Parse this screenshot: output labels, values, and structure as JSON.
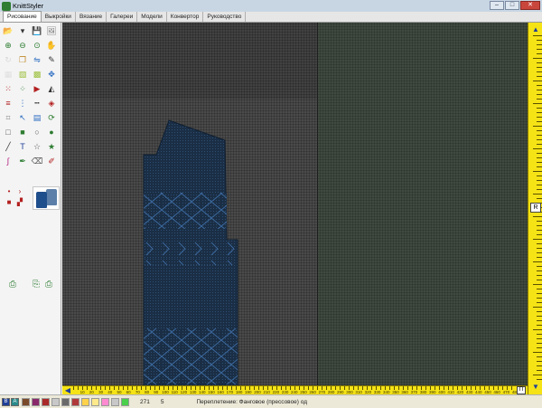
{
  "window": {
    "title": "KnittStyler"
  },
  "tabs": [
    {
      "label": "Рисование",
      "active": true
    },
    {
      "label": "Выкройки",
      "active": false
    },
    {
      "label": "Вязание",
      "active": false
    },
    {
      "label": "Галереи",
      "active": false
    },
    {
      "label": "Модели",
      "active": false
    },
    {
      "label": "Конвертор",
      "active": false
    },
    {
      "label": "Руководство",
      "active": false
    }
  ],
  "toolbar": {
    "tools": [
      {
        "name": "open-folder-icon",
        "glyph": "📂",
        "color": "#c08a2a"
      },
      {
        "name": "dropdown-icon",
        "glyph": "▾",
        "color": "#333"
      },
      {
        "name": "save-icon",
        "glyph": "💾",
        "color": "#1f3f99"
      },
      {
        "name": "gallery-icon",
        "glyph": "🖼",
        "color": "#777"
      },
      {
        "name": "zoom-in-icon",
        "glyph": "⊕",
        "color": "#2e7d32"
      },
      {
        "name": "zoom-out-icon",
        "glyph": "⊖",
        "color": "#2e7d32"
      },
      {
        "name": "zoom-fit-icon",
        "glyph": "⊙",
        "color": "#2e7d32"
      },
      {
        "name": "hand-pan-icon",
        "glyph": "✋",
        "color": "#888"
      },
      {
        "name": "rotate-icon",
        "glyph": "↻",
        "color": "#aaa"
      },
      {
        "name": "copy-pattern-icon",
        "glyph": "❐",
        "color": "#c08a2a"
      },
      {
        "name": "mirror-icon",
        "glyph": "⇋",
        "color": "#2a6bc0"
      },
      {
        "name": "pencil-icon",
        "glyph": "✎",
        "color": "#333"
      },
      {
        "name": "grid-disabled-icon",
        "glyph": "▦",
        "color": "#bbb"
      },
      {
        "name": "select-area-icon",
        "glyph": "▧",
        "color": "#9bbf3a"
      },
      {
        "name": "fill-area-icon",
        "glyph": "▩",
        "color": "#9bbf3a"
      },
      {
        "name": "move-icon",
        "glyph": "✥",
        "color": "#2a6bc0"
      },
      {
        "name": "stitch-red-icon",
        "glyph": "⁙",
        "color": "#b32020"
      },
      {
        "name": "stitch-green-icon",
        "glyph": "⁘",
        "color": "#2e7d32"
      },
      {
        "name": "play-icon",
        "glyph": "▶",
        "color": "#b32020"
      },
      {
        "name": "triangle-icon",
        "glyph": "◭",
        "color": "#333"
      },
      {
        "name": "row-numbers-icon",
        "glyph": "≡",
        "color": "#b32020"
      },
      {
        "name": "dots-icon",
        "glyph": "⋮",
        "color": "#2a6bc0"
      },
      {
        "name": "dotted-line-icon",
        "glyph": "┅",
        "color": "#333"
      },
      {
        "name": "diamond-stitch-icon",
        "glyph": "◈",
        "color": "#b32020"
      },
      {
        "name": "crop-icon",
        "glyph": "⌗",
        "color": "#888"
      },
      {
        "name": "arrow-select-icon",
        "glyph": "↖",
        "color": "#2a6bc0"
      },
      {
        "name": "blocks-icon",
        "glyph": "▤",
        "color": "#2a6bc0"
      },
      {
        "name": "refresh-icon",
        "glyph": "⟳",
        "color": "#2e7d32"
      },
      {
        "name": "rectangle-icon",
        "glyph": "□",
        "color": "#555"
      },
      {
        "name": "filled-rectangle-icon",
        "glyph": "■",
        "color": "#2e7d32"
      },
      {
        "name": "ellipse-icon",
        "glyph": "○",
        "color": "#555"
      },
      {
        "name": "filled-ellipse-icon",
        "glyph": "●",
        "color": "#2e7d32"
      },
      {
        "name": "line-icon",
        "glyph": "╱",
        "color": "#333"
      },
      {
        "name": "text-icon",
        "glyph": "T",
        "color": "#1f3f99"
      },
      {
        "name": "star-outline-icon",
        "glyph": "☆",
        "color": "#555"
      },
      {
        "name": "star-filled-icon",
        "glyph": "★",
        "color": "#2e7d32"
      },
      {
        "name": "curve-icon",
        "glyph": "∫",
        "color": "#b32080"
      },
      {
        "name": "brush-icon",
        "glyph": "✒",
        "color": "#2e7d32"
      },
      {
        "name": "eraser-icon",
        "glyph": "⌫",
        "color": "#555"
      },
      {
        "name": "eyedropper-icon",
        "glyph": "✐",
        "color": "#b32020"
      }
    ],
    "mini_tools": [
      {
        "name": "small-dot-red-icon",
        "glyph": "•",
        "color": "#b32020"
      },
      {
        "name": "arrow-right-small-icon",
        "glyph": "›",
        "color": "#b32020"
      },
      {
        "name": "square-red-icon",
        "glyph": "■",
        "color": "#b32020"
      },
      {
        "name": "checker-icon",
        "glyph": "▞",
        "color": "#b32020"
      }
    ],
    "bottom_tools": [
      {
        "name": "print-pattern-icon",
        "glyph": "⎙",
        "color": "#2e7d32"
      },
      {
        "name": "print-multi-icon",
        "glyph": "⎘",
        "color": "#2e7d32"
      },
      {
        "name": "print-green-icon",
        "glyph": "⎙",
        "color": "#2e7d32"
      }
    ]
  },
  "canvas": {
    "left_color": "#4a4a4a",
    "right_color": "#404a40",
    "garment_color": "#1a2e45",
    "garment_pattern_color": "#3c6aa0"
  },
  "ruler": {
    "vertical_label": "R",
    "horizontal_label": "П",
    "horizontal_ticks": [
      "10",
      "20",
      "30",
      "40",
      "50",
      "60",
      "70",
      "80",
      "90",
      "100",
      "110",
      "120",
      "130",
      "140",
      "150",
      "160",
      "170",
      "180",
      "190",
      "200",
      "210",
      "220",
      "230",
      "240",
      "250",
      "260",
      "270",
      "280",
      "290",
      "300",
      "310",
      "320",
      "330",
      "340",
      "350",
      "360",
      "370",
      "380",
      "390",
      "400",
      "410",
      "420",
      "430",
      "440",
      "450",
      "460",
      "470",
      "480"
    ]
  },
  "statusbar": {
    "buttons": [
      {
        "name": "color-b-button",
        "label": "B",
        "color": "#1f3f99"
      },
      {
        "name": "color-a-button",
        "label": "A",
        "color": "#2a8a8a"
      }
    ],
    "swatches": [
      "#7a4a2a",
      "#8a2a6a",
      "#aa2a2a",
      "#c8c8c8",
      "#6a6a6a",
      "#b03a3a",
      "#ffd24a",
      "#ffe98a",
      "#ff8ad0",
      "#c8c8c8",
      "#4ad04a"
    ],
    "count": "271",
    "value": "5",
    "message": "Переплетение: Фанговое (прессовое) од"
  }
}
